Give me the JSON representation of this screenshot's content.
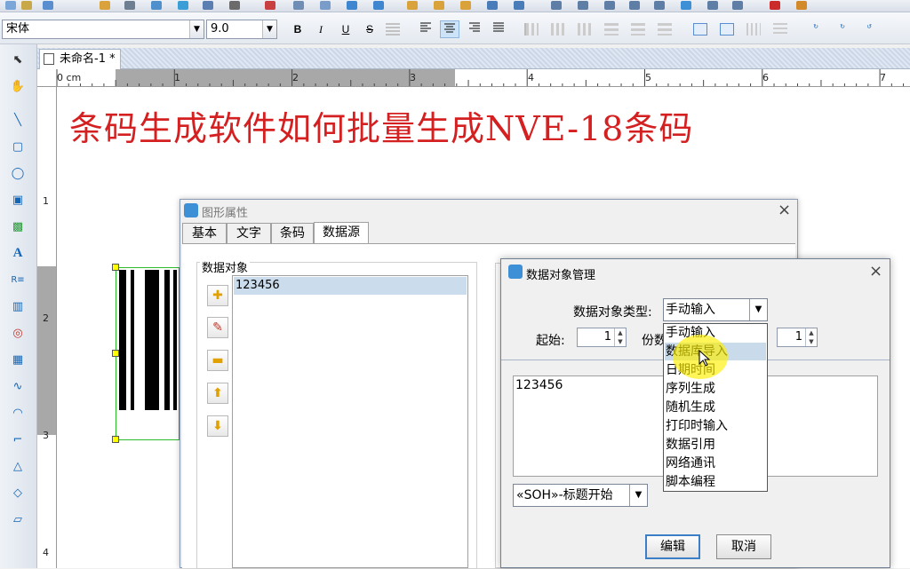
{
  "format_bar": {
    "font_name": "宋体",
    "font_size": "9.0",
    "bold": "B",
    "italic": "I",
    "underline": "U",
    "strike": "S"
  },
  "document": {
    "tab_title": "未命名-1 *"
  },
  "ruler": {
    "h_labels": [
      "0 cm",
      "1",
      "2",
      "3",
      "4",
      "5",
      "6",
      "7"
    ],
    "v_labels": [
      "1",
      "2",
      "3",
      "4"
    ]
  },
  "canvas": {
    "headline": "条码生成软件如何批量生成NVE-18条码"
  },
  "graphic_props": {
    "title": "图形属性",
    "tabs": [
      "基本",
      "文字",
      "条码",
      "数据源"
    ],
    "active_tab": "数据源",
    "group_label": "数据对象",
    "items": [
      "123456"
    ]
  },
  "data_manager": {
    "title": "数据对象管理",
    "type_label": "数据对象类型:",
    "type_value": "手动输入",
    "type_options": [
      "手动输入",
      "数据库导入",
      "日期时间",
      "序列生成",
      "随机生成",
      "打印时输入",
      "数据引用",
      "网络通讯",
      "脚本编程"
    ],
    "highlighted_option": "数据库导入",
    "start_label": "起始:",
    "start_value": "1",
    "copies_label": "份数",
    "copies_value": "1",
    "content": "123456",
    "control_char": "«SOH»-标题开始",
    "edit_button": "编辑",
    "cancel_button": "取消"
  },
  "colors": {
    "headline": "#d42020",
    "selection_border": "#2bbb2b",
    "highlight": "#c9daea",
    "cursor_highlight": "#fff000"
  }
}
